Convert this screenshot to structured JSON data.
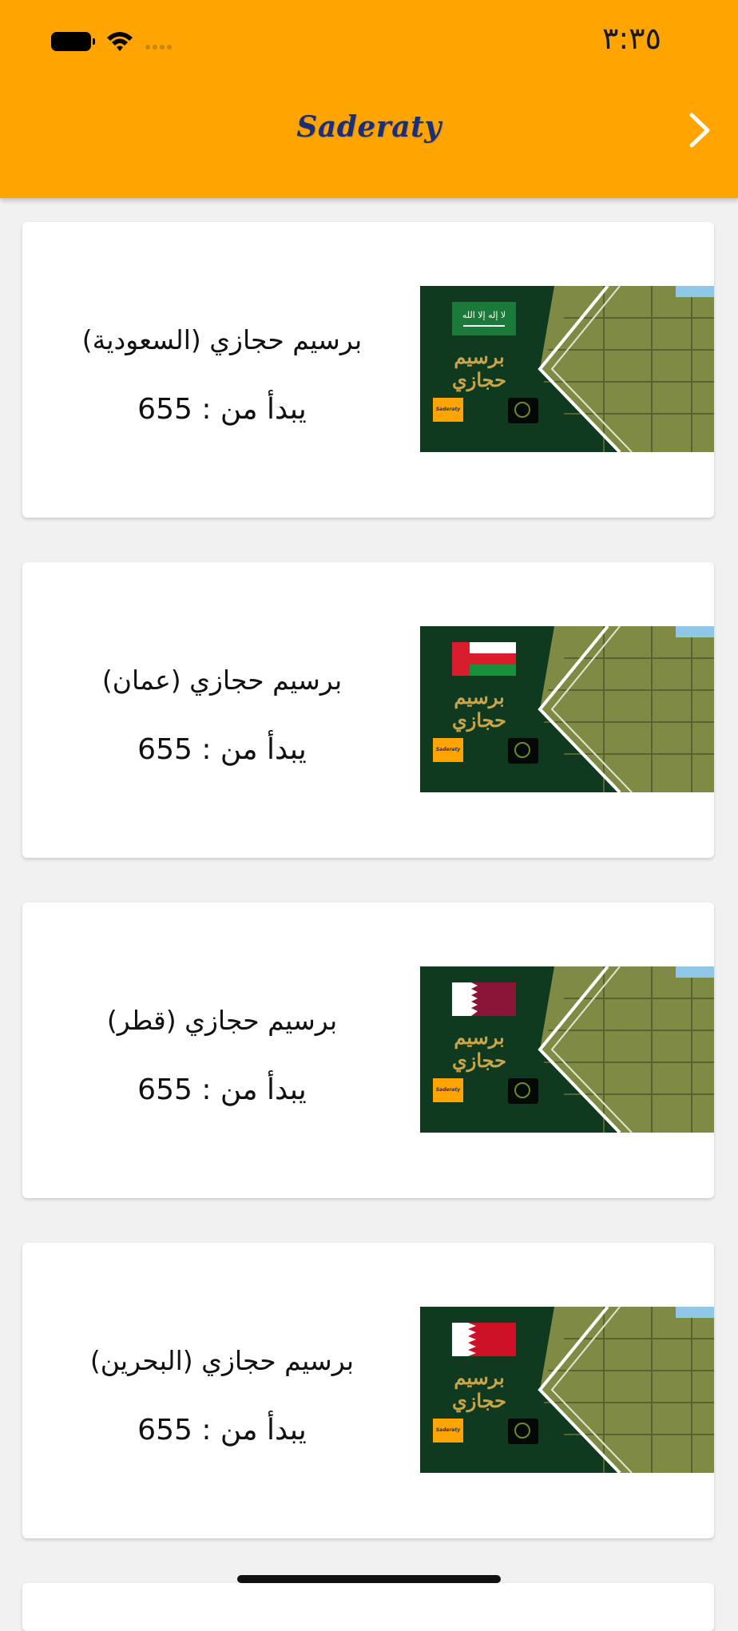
{
  "status_bar": {
    "time": "٣:٣٥"
  },
  "header": {
    "brand": "Saderaty",
    "nav_icon": "chevron-right-icon",
    "background_color": "#ffa400",
    "brand_color": "#1d2e78"
  },
  "products": [
    {
      "title": "برسيم حجازي (السعودية)",
      "price": "يبدأ من : 655",
      "thumb_title": "برسيم حجازي",
      "thumb_brand": "Saderaty",
      "flag": "saudi-arabia"
    },
    {
      "title": "برسيم حجازي (عمان)",
      "price": "يبدأ من : 655",
      "thumb_title": "برسيم حجازي",
      "thumb_brand": "Saderaty",
      "flag": "oman"
    },
    {
      "title": "برسيم حجازي (قطر)",
      "price": "يبدأ من : 655",
      "thumb_title": "برسيم حجازي",
      "thumb_brand": "Saderaty",
      "flag": "qatar"
    },
    {
      "title": "برسيم حجازي (البحرين)",
      "price": "يبدأ من : 655",
      "thumb_title": "برسيم حجازي",
      "thumb_brand": "Saderaty",
      "flag": "bahrain"
    }
  ]
}
